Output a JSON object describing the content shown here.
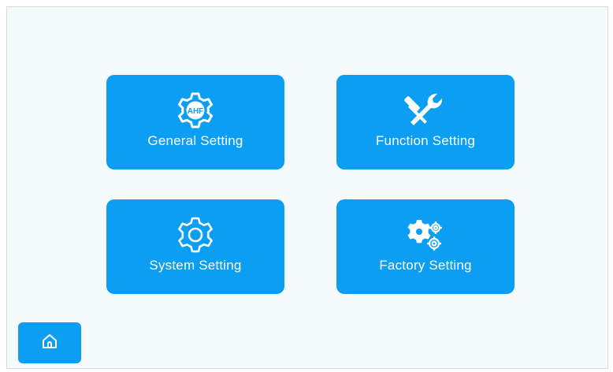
{
  "tiles": [
    {
      "label": "General Setting",
      "icon": "gear-ahf-icon",
      "badge": "AHF"
    },
    {
      "label": "Function Setting",
      "icon": "tools-icon"
    },
    {
      "label": "System Setting",
      "icon": "gear-outline-icon"
    },
    {
      "label": "Factory Setting",
      "icon": "gears-icon"
    }
  ],
  "home": {
    "icon": "home-icon"
  },
  "colors": {
    "accent": "#0b9ef2",
    "background": "#f5fbfc",
    "text": "#ffffff"
  }
}
